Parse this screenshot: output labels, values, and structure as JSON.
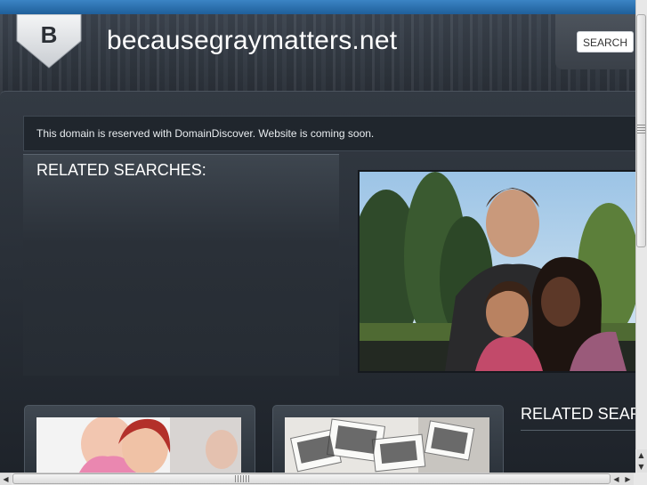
{
  "header": {
    "logo_letter": "B",
    "site_title": "becausegraymatters.net",
    "search_label": "SEARCH"
  },
  "notice": {
    "text": "This domain is reserved with DomainDiscover. Website is coming soon."
  },
  "sections": {
    "related_searches_title": "RELATED SEARCHES:",
    "related_searches_title_2": "RELATED SEARCHES:"
  },
  "colors": {
    "accent_blue": "#2f74b3",
    "panel_dark": "#20262d",
    "text_light": "#ffffff"
  },
  "scrollbars": {
    "up_arrow": "▲",
    "down_arrow": "▼",
    "left_arrow": "◀",
    "right_arrow": "▶"
  }
}
